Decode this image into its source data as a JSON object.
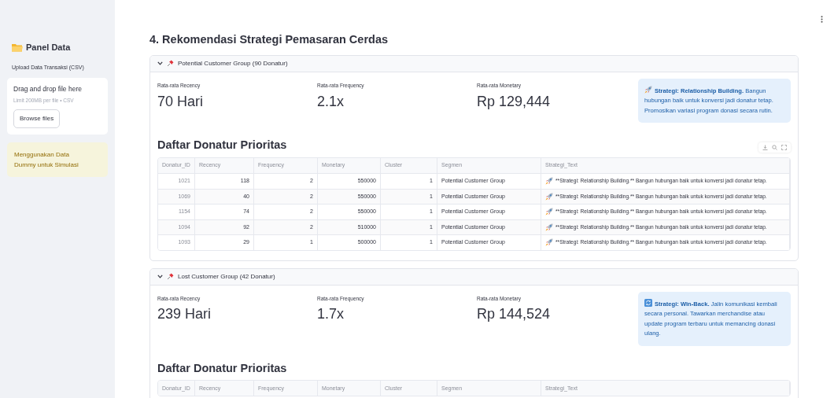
{
  "sidebar": {
    "title": "Panel Data",
    "uploader": {
      "label": "Upload Data Transaksi (CSV)",
      "drop_text": "Drag and drop file here",
      "limit_text": "Limit 200MB per file • CSV",
      "button": "Browse files"
    },
    "notice": "Menggunakan Data Dummy untuk Simulasi"
  },
  "page_title": "4. Rekomendasi Strategi Pemasaran Cerdas",
  "sections": [
    {
      "title": "Potential Customer Group (90 Donatur)",
      "expanded": true,
      "metrics": [
        {
          "label": "Rata-rata Recency",
          "value": "70 Hari"
        },
        {
          "label": "Rata-rata Frequency",
          "value": "2.1x"
        },
        {
          "label": "Rata-rata Monetary",
          "value": "Rp 129,444"
        }
      ],
      "strategy": {
        "kind": "rocket",
        "text": "**Strategi: Relationship Building.** Bangun hubungan baik untuk konversi jadi donatur tetap. Promosikan variasi program donasi secara rutin."
      },
      "table_title": "Daftar Donatur Prioritas",
      "toolbar": true,
      "columns": [
        "Donatur_ID",
        "Recency",
        "Frequency",
        "Monetary",
        "Cluster",
        "Segmen",
        "Strategi_Text"
      ],
      "rows": [
        [
          "1021",
          "118",
          "2",
          "550000",
          "1",
          "Potential Customer Group",
          "**Strategi: Relationship Building.** Bangun hubungan baik untuk konversi jadi donatur tetap."
        ],
        [
          "1069",
          "40",
          "2",
          "550000",
          "1",
          "Potential Customer Group",
          "**Strategi: Relationship Building.** Bangun hubungan baik untuk konversi jadi donatur tetap."
        ],
        [
          "1154",
          "74",
          "2",
          "550000",
          "1",
          "Potential Customer Group",
          "**Strategi: Relationship Building.** Bangun hubungan baik untuk konversi jadi donatur tetap."
        ],
        [
          "1094",
          "92",
          "2",
          "510000",
          "1",
          "Potential Customer Group",
          "**Strategi: Relationship Building.** Bangun hubungan baik untuk konversi jadi donatur tetap."
        ],
        [
          "1093",
          "29",
          "1",
          "500000",
          "1",
          "Potential Customer Group",
          "**Strategi: Relationship Building.** Bangun hubungan baik untuk konversi jadi donatur tetap."
        ]
      ]
    },
    {
      "title": "Lost Customer Group (42 Donatur)",
      "expanded": true,
      "metrics": [
        {
          "label": "Rata-rata Recency",
          "value": "239 Hari"
        },
        {
          "label": "Rata-rata Frequency",
          "value": "1.7x"
        },
        {
          "label": "Rata-rata Monetary",
          "value": "Rp 144,524"
        }
      ],
      "strategy": {
        "kind": "refresh",
        "text": "**Strategi: Win-Back.** Jalin komunikasi kembali secara personal. Tawarkan merchandise atau update program terbaru untuk memancing donasi ulang."
      },
      "table_title": "Daftar Donatur Prioritas",
      "toolbar": false,
      "columns": [
        "Donatur_ID",
        "Recency",
        "Frequency",
        "Monetary",
        "Cluster",
        "Segmen",
        "Strategi_Text"
      ]
    }
  ]
}
